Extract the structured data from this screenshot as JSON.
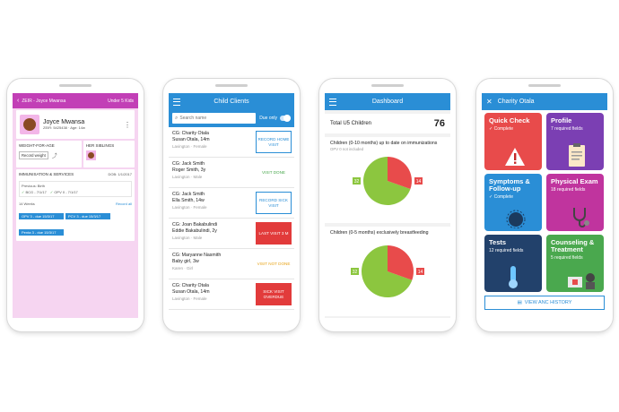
{
  "screen1": {
    "header_title": "ZEIR - Joyce Mwansa",
    "header_action": "Under 5 Kids",
    "name": "Joyce Mwansa",
    "subline": "ZEIR: 5425438 · Age: 14w",
    "weight_label": "WEIGHT-FOR-AGE",
    "siblings_label": "HER SIBLINGS",
    "record_weight": "Record weight",
    "immun_label": "IMMUNISATION & SERVICES",
    "dob": "DOB: 1/1/2017",
    "previous_birth": "Previous: Birth",
    "bcg": "BCG - 7/1/17",
    "opv0": "OPV 0 - 7/1/17",
    "weeks": "14 Weeks",
    "record_all": "Record all",
    "opv3": "OPV 3 - due 15/3/17",
    "pcv3": "PCV 3 - due 15/3/17",
    "penta3": "Penta 3 - due 15/3/17"
  },
  "screen2": {
    "title": "Child Clients",
    "search_placeholder": "Search name",
    "due_only": "Due only",
    "rows": [
      {
        "l1": "CG: Charity Otala",
        "l2": "Susan Otala, 14m",
        "loc": "Lavington · Female",
        "status": "RECORD HOME VISIT"
      },
      {
        "l1": "CG: Jack Smith",
        "l2": "Roger Smith, 3y",
        "loc": "Lavington · Male",
        "status": "VISIT DONE"
      },
      {
        "l1": "CG: Jack Smith",
        "l2": "Ella Smith, 14w",
        "loc": "Lavington · Female",
        "status": "RECORD SICK VISIT"
      },
      {
        "l1": "CG: Joan Bakabulindi",
        "l2": "Eddie Bakabulindi, 2y",
        "loc": "Lavington · Male",
        "status": "LAST VISIT 3 M"
      },
      {
        "l1": "CG: Maryanne Nasmith",
        "l2": "Baby girl, 3w",
        "loc": "Karen · Girl",
        "status": "VISIT NOT DONE"
      },
      {
        "l1": "CG: Charity Otala",
        "l2": "Susan Otala, 14m",
        "loc": "Lavington · Female",
        "status": "SICK VISIT OVERDUE"
      }
    ]
  },
  "screen3": {
    "title": "Dashboard",
    "total_label": "Total U5 Children",
    "total_value": "76",
    "card1_title": "Children (0-10 months) up to date on immunizations",
    "card1_note": "OPV 0 not included",
    "card2_title": "Children (0-5 months) exclusively breastfeeding",
    "pie1": {
      "green": 32,
      "red": 14
    },
    "pie2": {
      "green": 32,
      "red": 14
    },
    "green_color": "#8cc63f",
    "red_color": "#e84b4b"
  },
  "screen4": {
    "title": "Charity Otala",
    "tiles": [
      {
        "title": "Quick Check",
        "sub": "✓ Complete",
        "color": "#e84b4b"
      },
      {
        "title": "Profile",
        "sub": "7 required fields",
        "color": "#7b3fb3"
      },
      {
        "title": "Symptoms & Follow-up",
        "sub": "✓ Complete",
        "color": "#2a8ed6"
      },
      {
        "title": "Physical Exam",
        "sub": "18 required fields",
        "color": "#c0349e"
      },
      {
        "title": "Tests",
        "sub": "12 required fields",
        "color": "#22416b"
      },
      {
        "title": "Counseling & Treatment",
        "sub": "5 required fields",
        "color": "#4aa84e"
      }
    ],
    "history_btn": "VIEW ANC HISTORY"
  }
}
